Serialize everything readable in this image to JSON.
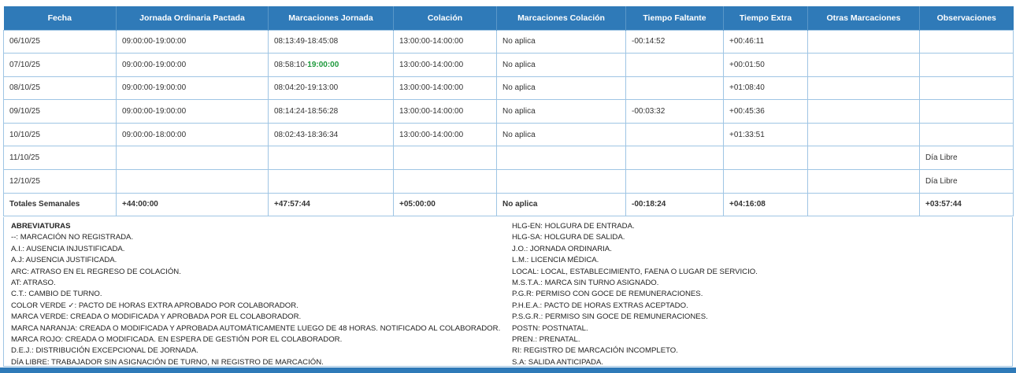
{
  "table": {
    "headers": [
      "Fecha",
      "Jornada Ordinaria Pactada",
      "Marcaciones Jornada",
      "Colación",
      "Marcaciones Colación",
      "Tiempo Faltante",
      "Tiempo Extra",
      "Otras Marcaciones",
      "Observaciones"
    ],
    "rows": [
      {
        "fecha": "06/10/25",
        "jornada": "09:00:00-19:00:00",
        "marc_start": "08:13:49-",
        "marc_end": "18:45:08",
        "colacion": "13:00:00-14:00:00",
        "marc_colacion": "No aplica",
        "faltante": "-00:14:52",
        "extra": "+00:46:11",
        "otras": "",
        "obs": ""
      },
      {
        "fecha": "07/10/25",
        "jornada": "09:00:00-19:00:00",
        "marc_start": "08:58:10-",
        "marc_end": "19:00:00",
        "colacion": "13:00:00-14:00:00",
        "marc_colacion": "No aplica",
        "faltante": "",
        "extra": "+00:01:50",
        "otras": "",
        "obs": ""
      },
      {
        "fecha": "08/10/25",
        "jornada": "09:00:00-19:00:00",
        "marc_start": "08:04:20-",
        "marc_end": "19:13:00",
        "colacion": "13:00:00-14:00:00",
        "marc_colacion": "No aplica",
        "faltante": "",
        "extra": "+01:08:40",
        "otras": "",
        "obs": ""
      },
      {
        "fecha": "09/10/25",
        "jornada": "09:00:00-19:00:00",
        "marc_start": "08:14:24-",
        "marc_end": "18:56:28",
        "colacion": "13:00:00-14:00:00",
        "marc_colacion": "No aplica",
        "faltante": "-00:03:32",
        "extra": "+00:45:36",
        "otras": "",
        "obs": ""
      },
      {
        "fecha": "10/10/25",
        "jornada": "09:00:00-18:00:00",
        "marc_start": "08:02:43-",
        "marc_end": "18:36:34",
        "colacion": "13:00:00-14:00:00",
        "marc_colacion": "No aplica",
        "faltante": "",
        "extra": "+01:33:51",
        "otras": "",
        "obs": ""
      },
      {
        "fecha": "11/10/25",
        "jornada": "",
        "marc_start": "",
        "marc_end": "",
        "colacion": "",
        "marc_colacion": "",
        "faltante": "",
        "extra": "",
        "otras": "",
        "obs": "Día Libre"
      },
      {
        "fecha": "12/10/25",
        "jornada": "",
        "marc_start": "",
        "marc_end": "",
        "colacion": "",
        "marc_colacion": "",
        "faltante": "",
        "extra": "",
        "otras": "",
        "obs": "Día Libre"
      }
    ],
    "totals": {
      "label": "Totales Semanales",
      "jornada": "+44:00:00",
      "marcaciones": "+47:57:44",
      "colacion": "+05:00:00",
      "marc_colacion": "No aplica",
      "faltante": "-00:18:24",
      "extra": "+04:16:08",
      "otras": "",
      "obs": "+03:57:44"
    }
  },
  "abbreviations": {
    "title": "ABREVIATURAS",
    "left": [
      "--: MARCACIÓN NO REGISTRADA.",
      "A.I.: AUSENCIA INJUSTIFICADA.",
      "A.J: AUSENCIA JUSTIFICADA.",
      "ARC: ATRASO EN EL REGRESO DE COLACIÓN.",
      "AT: ATRASO.",
      "C.T.: CAMBIO DE TURNO.",
      "COLOR VERDE ✓: PACTO DE HORAS EXTRA APROBADO POR COLABORADOR.",
      "MARCA VERDE: CREADA O MODIFICADA Y APROBADA POR EL COLABORADOR.",
      "MARCA NARANJA: CREADA O MODIFICADA Y APROBADA AUTOMÁTICAMENTE LUEGO DE 48 HORAS. NOTIFICADO AL COLABORADOR.",
      "MARCA ROJO: CREADA O MODIFICADA. EN ESPERA DE GESTIÓN POR EL COLABORADOR.",
      "D.E.J.: DISTRIBUCIÓN EXCEPCIONAL DE JORNADA.",
      "DÍA LIBRE: TRABAJADOR SIN ASIGNACIÓN DE TURNO, NI REGISTRO DE MARCACIÓN."
    ],
    "right": [
      "HLG-EN: HOLGURA DE ENTRADA.",
      "HLG-SA: HOLGURA DE SALIDA.",
      "J.O.: JORNADA ORDINARIA.",
      "L.M.: LICENCIA MÉDICA.",
      "LOCAL: LOCAL, ESTABLECIMIENTO, FAENA O LUGAR DE SERVICIO.",
      "M.S.T.A.: MARCA SIN TURNO ASIGNADO.",
      "P.G.R: PERMISO CON GOCE DE REMUNERACIONES.",
      "P.H.E.A.: PACTO DE HORAS EXTRAS ACEPTADO.",
      "P.S.G.R.: PERMISO SIN GOCE DE REMUNERACIONES.",
      "POSTN: POSTNATAL.",
      "PREN.: PRENATAL.",
      "RI: REGISTRO DE MARCACIÓN INCOMPLETO.",
      "S.A: SALIDA ANTICIPADA."
    ]
  },
  "colors": {
    "header_bg": "#2f7ab8",
    "border": "#9fc5e4",
    "approved_green": "#1e9a3c"
  }
}
